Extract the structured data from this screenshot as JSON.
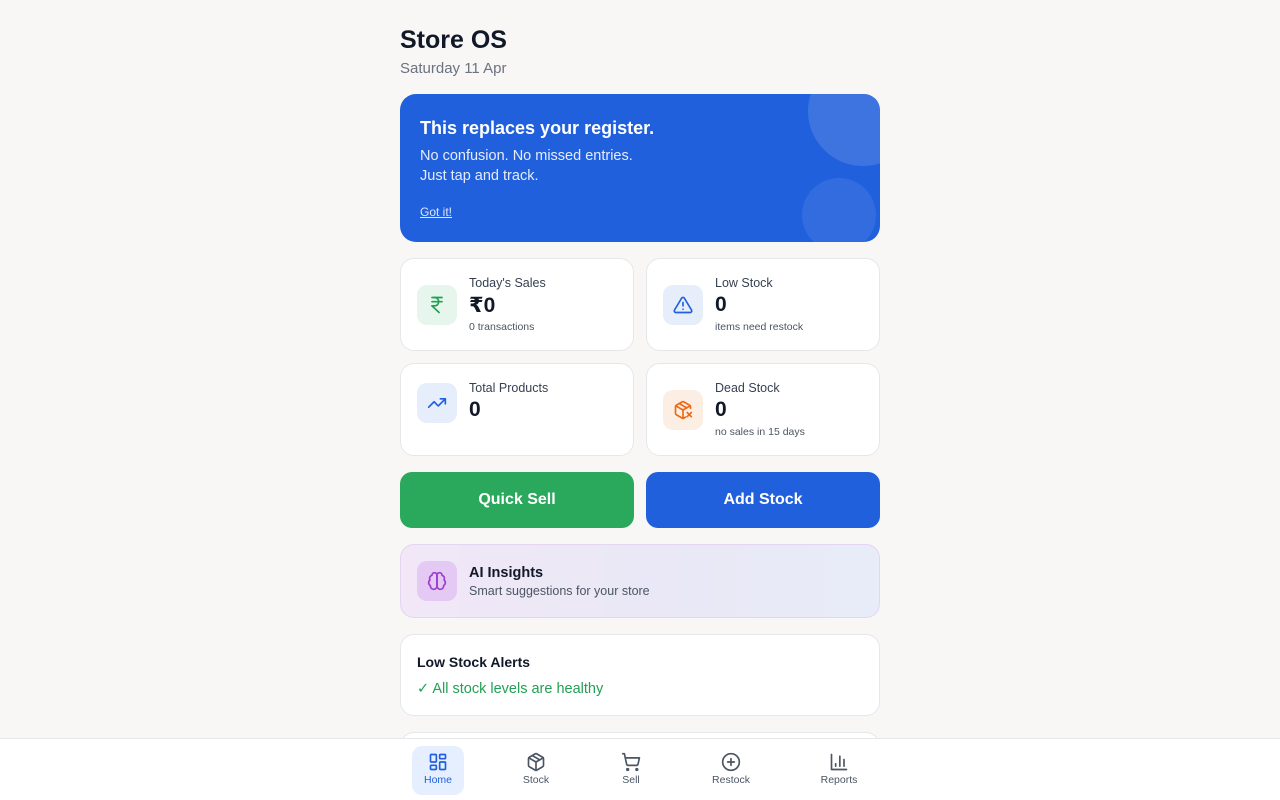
{
  "header": {
    "title": "Store OS",
    "date": "Saturday 11 Apr"
  },
  "banner": {
    "title": "This replaces your register.",
    "line1": "No confusion. No missed entries.",
    "line2": "Just tap and track.",
    "dismiss_label": "Got it!",
    "bg_color": "#2160dc"
  },
  "stats": [
    {
      "label": "Today's Sales",
      "value": "₹0",
      "sub": "0 transactions",
      "icon": "rupee-icon",
      "icon_color": "#22a055",
      "icon_bg": "#e6f6ec"
    },
    {
      "label": "Low Stock",
      "value": "0",
      "sub": "items need restock",
      "icon": "alert-triangle-icon",
      "icon_color": "#2160dc",
      "icon_bg": "#e6edfb"
    },
    {
      "label": "Total Products",
      "value": "0",
      "sub": "",
      "icon": "trending-up-icon",
      "icon_color": "#2160dc",
      "icon_bg": "#e6edfb"
    },
    {
      "label": "Dead Stock",
      "value": "0",
      "sub": "no sales in 15 days",
      "icon": "package-x-icon",
      "icon_color": "#ea6a1a",
      "icon_bg": "#fdeee3"
    }
  ],
  "actions": {
    "quick_sell_label": "Quick Sell",
    "add_stock_label": "Add Stock",
    "quick_sell_color": "#2aa85c",
    "add_stock_color": "#2160dc"
  },
  "ai_insights": {
    "title": "AI Insights",
    "subtitle": "Smart suggestions for your store",
    "icon": "brain-icon",
    "icon_color": "#9b3fd0"
  },
  "low_stock_alerts": {
    "title": "Low Stock Alerts",
    "status": "✓ All stock levels are healthy",
    "status_color": "#22a055"
  },
  "nav": {
    "items": [
      {
        "label": "Home",
        "icon": "grid-icon",
        "active": true
      },
      {
        "label": "Stock",
        "icon": "box-icon",
        "active": false
      },
      {
        "label": "Sell",
        "icon": "cart-icon",
        "active": false
      },
      {
        "label": "Restock",
        "icon": "plus-circle-icon",
        "active": false
      },
      {
        "label": "Reports",
        "icon": "bar-chart-icon",
        "active": false
      }
    ]
  }
}
